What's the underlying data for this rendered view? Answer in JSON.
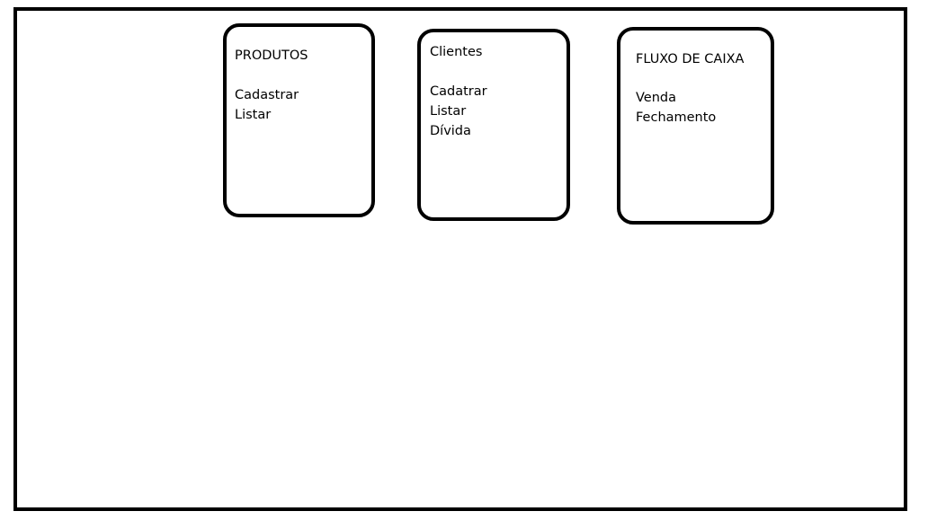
{
  "cards": [
    {
      "title": "PRODUTOS",
      "items": [
        "Cadastrar",
        "Listar"
      ]
    },
    {
      "title": "Clientes",
      "items": [
        "Cadatrar",
        "Listar",
        "Dívida"
      ]
    },
    {
      "title": "FLUXO DE CAIXA",
      "items": [
        "Venda",
        "Fechamento"
      ]
    }
  ]
}
